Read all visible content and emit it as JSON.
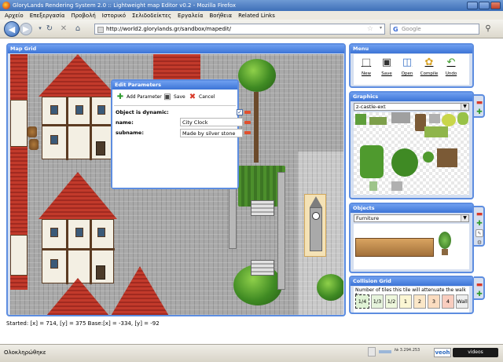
{
  "window": {
    "title": "GloryLands Rendering System 2.0 :: Lightweight map Editor v0.2 - Mozilla Firefox"
  },
  "browser_menu": [
    "Αρχείο",
    "Επεξεργασία",
    "Προβολή",
    "Ιστορικό",
    "Σελιδοδείκτες",
    "Εργαλεία",
    "Βοήθεια",
    "Related Links"
  ],
  "navigation": {
    "url": "http://world2.glorylands.gr/sandbox/mapedit/",
    "search_placeholder": "Google"
  },
  "map_grid": {
    "title": "Map Grid"
  },
  "edit_parameters": {
    "title": "Edit Parameters",
    "toolbar": {
      "add": "Add Parameter",
      "save": "Save",
      "cancel": "Cancel"
    },
    "rows": [
      {
        "label": "Object is dynamic:",
        "type": "checkbox",
        "checked": true
      },
      {
        "label": "name:",
        "value": "City Clock"
      },
      {
        "label": "subname:",
        "value": "Made by silver stone"
      }
    ]
  },
  "menu_panel": {
    "title": "Menu",
    "items": [
      "New",
      "Save",
      "Open",
      "Compile",
      "Undo"
    ]
  },
  "graphics_panel": {
    "title": "Graphics",
    "selected": "z-castle-ext"
  },
  "objects_panel": {
    "title": "Objects",
    "selected": "Furniture"
  },
  "collision_panel": {
    "title": "Collision Grid",
    "help": "Number of tiles this tile will attenuate the walk for:",
    "options": [
      "1/4",
      "1/3",
      "1/2",
      "1",
      "2",
      "3",
      "4",
      "Wall"
    ],
    "selected": "1/4"
  },
  "status_line": "Started: [x] = 714, [y] = 375 Base:[x] = -334, [y] = -92",
  "statusbar": {
    "text": "Ολοκληρώθηκε",
    "counter": "№ 3.294.253",
    "veoh": "veoh",
    "videos": "videos"
  },
  "colors": {
    "panel_title": "#3c74d6",
    "panel_bg": "#d5dff0",
    "roof": "#c23a2b"
  }
}
